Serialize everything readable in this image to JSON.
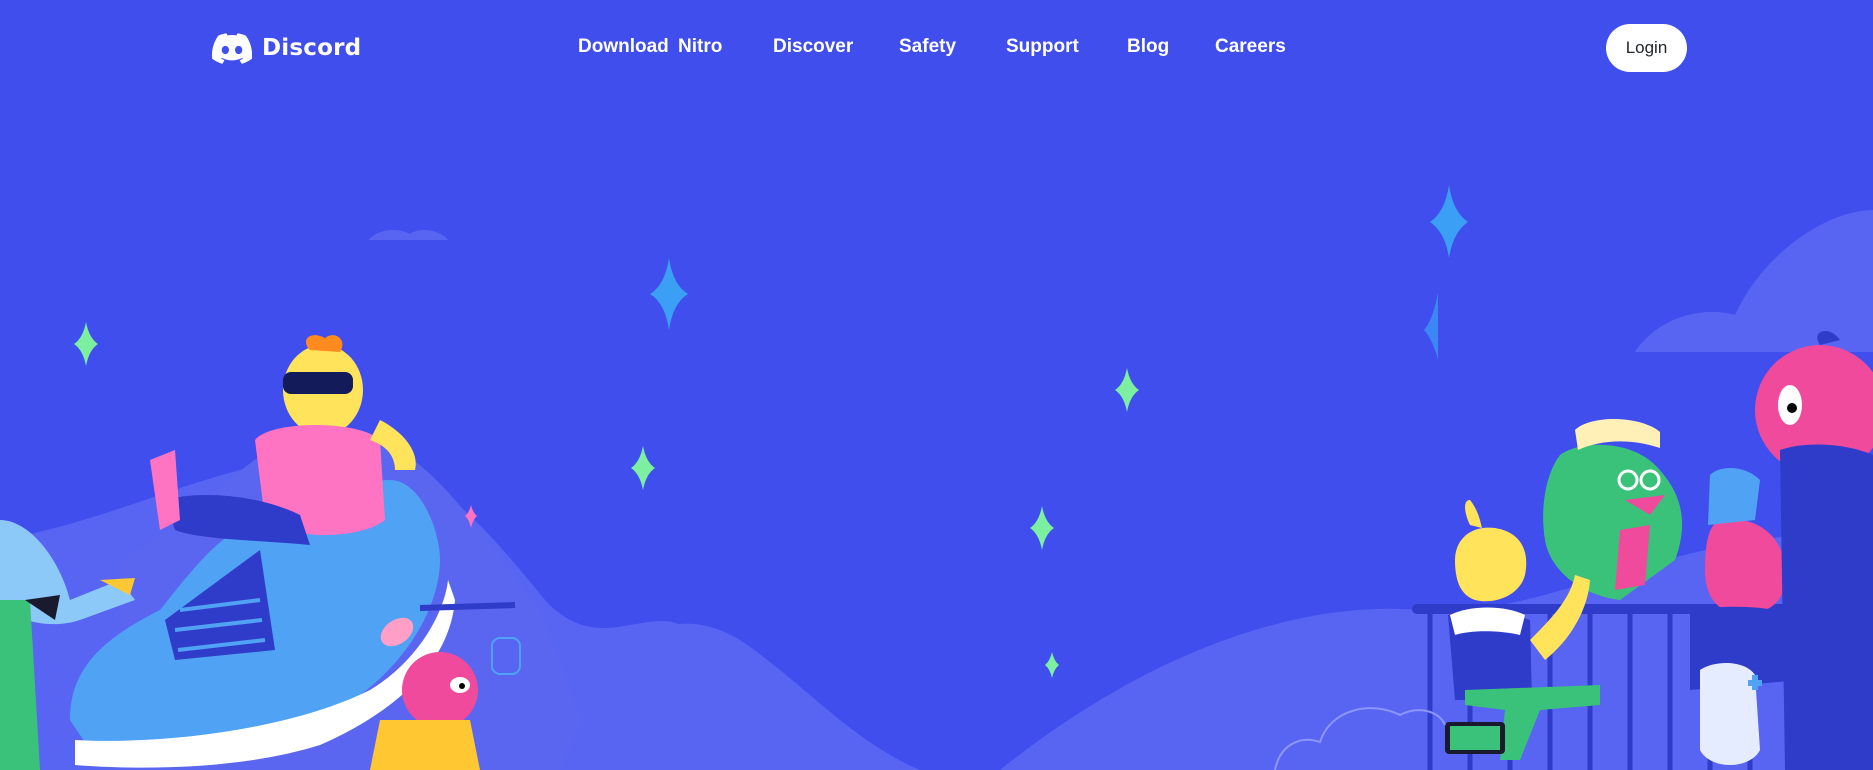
{
  "brand": {
    "name": "Discord",
    "logo_icon": "discord-clyde-icon"
  },
  "nav": {
    "links": [
      {
        "label": "Download"
      },
      {
        "label": "Nitro"
      },
      {
        "label": "Discover"
      },
      {
        "label": "Safety"
      },
      {
        "label": "Support"
      },
      {
        "label": "Blog"
      },
      {
        "label": "Careers"
      }
    ],
    "login_label": "Login"
  },
  "colors": {
    "background": "#404EED",
    "hills": "#5865F2",
    "sparkle_blue": "#3BA0F5",
    "sparkle_green": "#7CF0A0",
    "login_bg": "#FFFFFF"
  }
}
